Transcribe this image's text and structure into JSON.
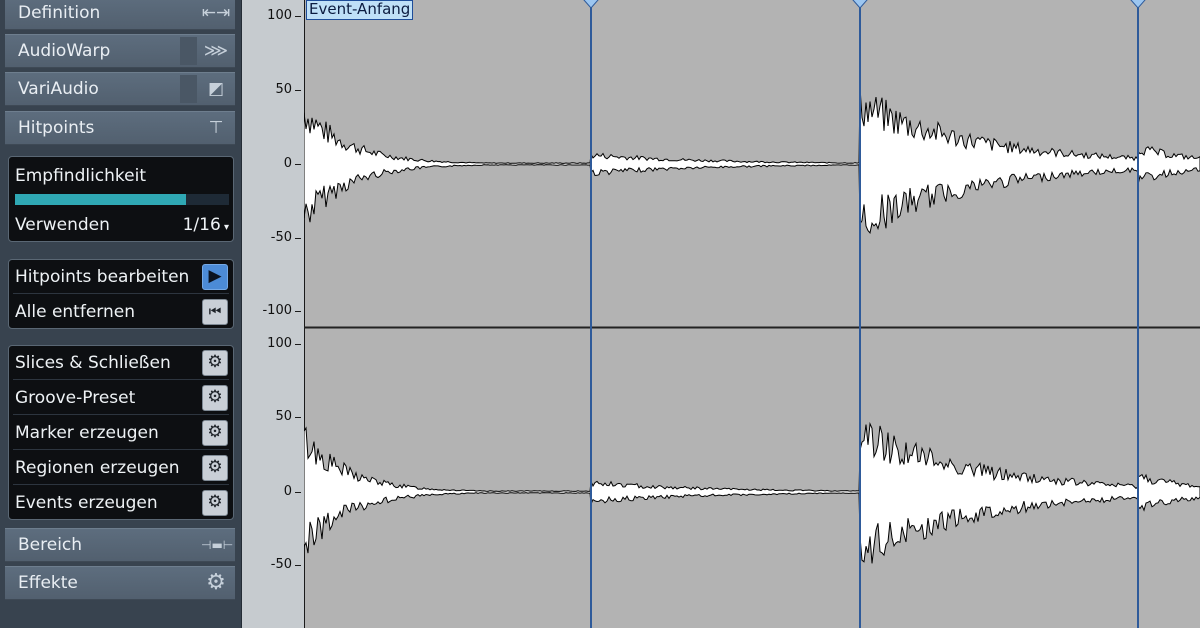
{
  "sidebar": {
    "sections_top": [
      {
        "label": "Definition",
        "icon": "range-arrows-icon",
        "glyph": "⇤⇥"
      },
      {
        "label": "AudioWarp",
        "icon": "warp-arrows-icon",
        "glyph": "⋙"
      },
      {
        "label": "VariAudio",
        "icon": "variaudio-icon",
        "glyph": "◩"
      },
      {
        "label": "Hitpoints",
        "icon": "hitpoint-marker-icon",
        "glyph": "⊤"
      }
    ],
    "sensitivity": {
      "label": "Empfindlichkeit",
      "level_fraction": 0.8
    },
    "use": {
      "label": "Verwenden",
      "value": "1/16"
    },
    "edit_hitpoints": "Hitpoints bearbeiten",
    "remove_all": "Alle entfernen",
    "actions": [
      "Slices & Schließen",
      "Groove-Preset",
      "Marker erzeugen",
      "Regionen erzeugen",
      "Events erzeugen"
    ],
    "sections_bottom": [
      {
        "label": "Bereich",
        "icon": "range-selection-icon",
        "glyph": "⊣▬⊢"
      },
      {
        "label": "Effekte",
        "icon": "gear-icon",
        "glyph": "⚙"
      }
    ]
  },
  "ruler": {
    "ticks": [
      "100",
      "50",
      "0",
      "-50",
      "-100"
    ]
  },
  "editor": {
    "event_label": "Event-Anfang"
  },
  "colors": {
    "waveform_bg": "#b3b3b3",
    "waveform_fill": "#ffffff",
    "hitpoint": "#2e5a9a",
    "accent": "#2fa8b4"
  }
}
